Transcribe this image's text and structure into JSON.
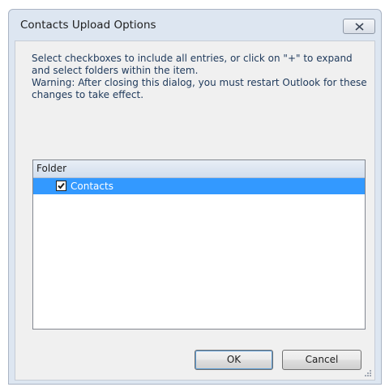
{
  "window": {
    "title": "Contacts Upload Options"
  },
  "instructions": {
    "line1": "Select checkboxes to include all entries, or click on \"+\" to expand and select folders within the item.",
    "line2": "Warning: After closing this dialog, you must restart Outlook for these changes to take effect."
  },
  "tree": {
    "header": "Folder",
    "items": [
      {
        "label": "Contacts",
        "checked": true,
        "selected": true
      }
    ]
  },
  "buttons": {
    "ok": "OK",
    "cancel": "Cancel"
  },
  "colors": {
    "selection": "#3399ff",
    "frame": "#dde6f1",
    "text": "#1e395b"
  },
  "icons": [
    "close-icon",
    "checkmark-icon",
    "resize-grip-icon"
  ]
}
